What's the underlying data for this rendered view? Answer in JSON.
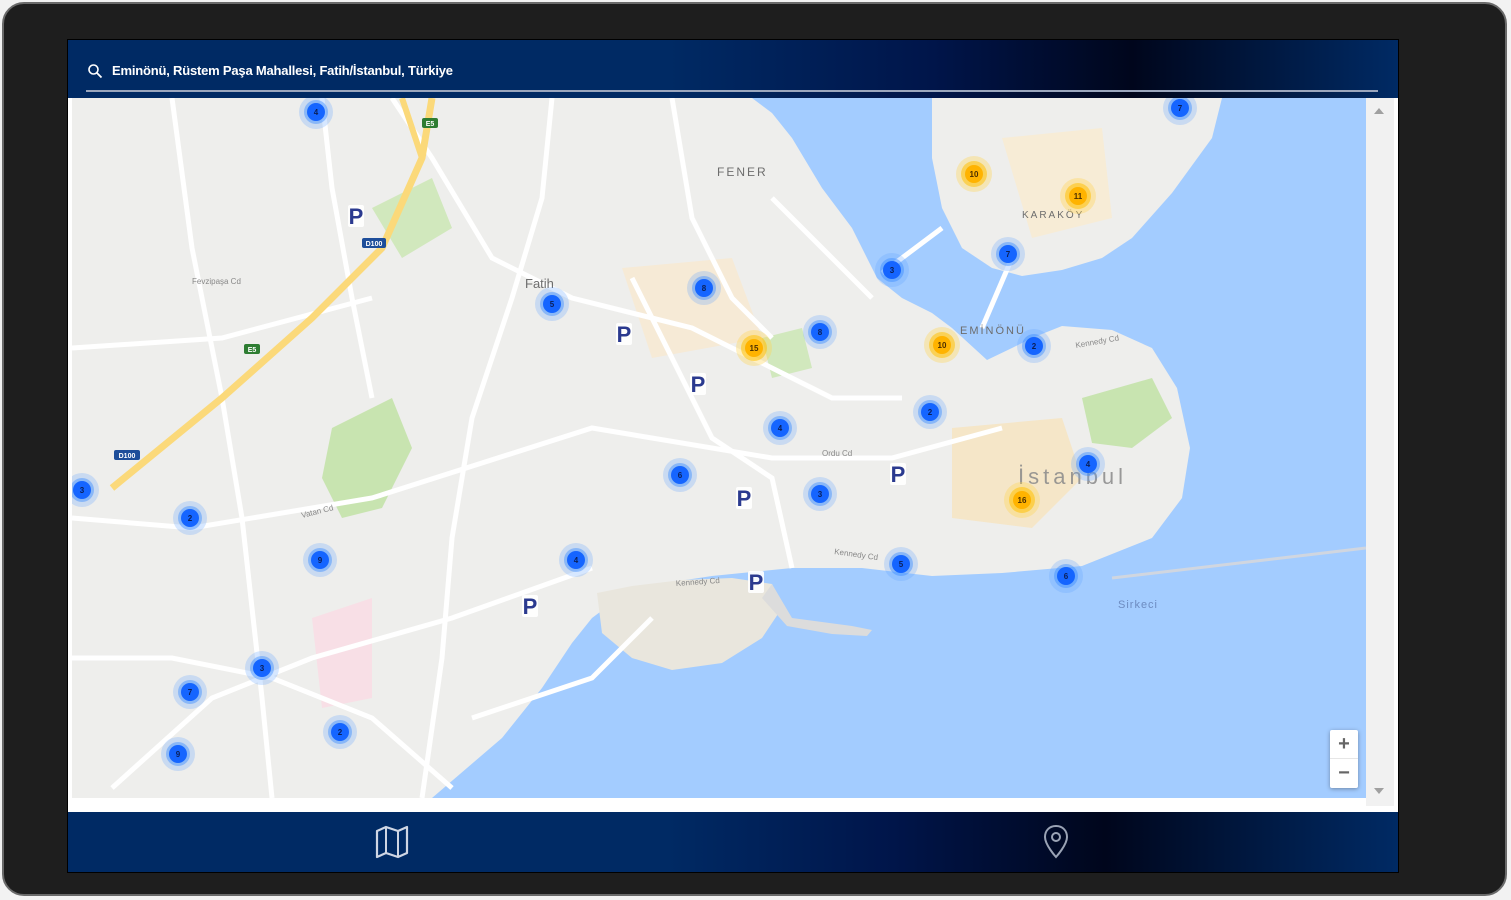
{
  "search": {
    "location_text": "Eminönü, Rüstem Paşa Mahallesi, Fatih/İstanbul, Türkiye",
    "icon": "search-icon"
  },
  "map": {
    "place_labels": [
      "FENER",
      "Fatih",
      "EMİNÖNÜ",
      "KARAKÖY",
      "İstanbul",
      "Sirkeci"
    ],
    "road_labels": [
      "Ordu Cd",
      "Kennedy Cd",
      "Kennedy Cd",
      "Kennedy Cd",
      "Fevzipaşa Cd",
      "Vatan Cd"
    ],
    "highway_badges": [
      "E5",
      "D100",
      "D100",
      "E5"
    ],
    "clusters_blue": [
      "4",
      "7",
      "3",
      "2",
      "9",
      "8",
      "5",
      "6",
      "4",
      "3",
      "8",
      "2",
      "3",
      "7",
      "2",
      "4",
      "6",
      "5"
    ],
    "clusters_yellow": [
      "10",
      "11",
      "15",
      "10",
      "16"
    ],
    "parking_marker": "P",
    "zoom_in": "+",
    "zoom_out": "−"
  },
  "bottom_nav": {
    "map_icon": "map-icon",
    "pin_icon": "location-pin-icon"
  },
  "colors": {
    "bar": "#002a64",
    "water": "#a3ccff",
    "cluster_blue": "#1565ff",
    "cluster_yellow": "#ffb300",
    "parking": "#2b3a8f"
  }
}
